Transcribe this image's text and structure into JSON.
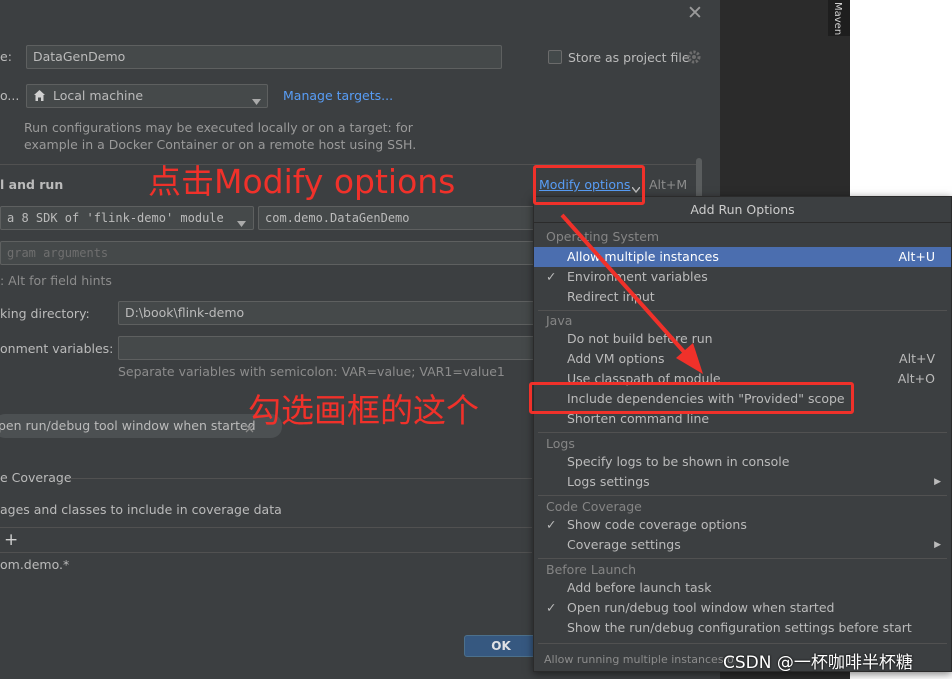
{
  "dialog": {
    "name_label": "e:",
    "name_value": "DataGenDemo",
    "store_label": "Store as project file",
    "run_on_label": "o...",
    "run_target": "Local machine",
    "manage_targets": "Manage targets...",
    "info_line1": "Run configurations may be executed locally or on a target: for",
    "info_line2": "example in a Docker Container or on a remote host using SSH.",
    "build_run_title": "l and run",
    "modify_options": "Modify options",
    "modify_shortcut": "Alt+M",
    "sdk_value": "a 8 SDK of 'flink-demo' module",
    "main_class": "com.demo.DataGenDemo",
    "program_args_placeholder": "gram arguments",
    "field_hints": ": Alt for field hints",
    "working_dir_label": "king directory:",
    "working_dir_value": "D:\\book\\flink-demo",
    "env_label": "onment variables:",
    "env_hint": "Separate variables with semicolon: VAR=value; VAR1=value1",
    "open_tool_window": "pen run/debug tool window when started",
    "coverage_title": "e Coverage",
    "coverage_include": "ages and classes to include in coverage data",
    "add_symbol": "+",
    "coverage_pattern": "om.demo.*",
    "ok_label": "OK",
    "close_symbol": "✕"
  },
  "side": {
    "maven_label": "Maven"
  },
  "popup": {
    "title": "Add Run Options",
    "groups": {
      "os": "Operating System",
      "java": "Java",
      "logs": "Logs",
      "coverage": "Code Coverage",
      "before": "Before Launch"
    },
    "items": [
      {
        "label": "Allow multiple instances",
        "shortcut": "Alt+U"
      },
      {
        "label": "Environment variables"
      },
      {
        "label": "Redirect input"
      },
      {
        "label": "Do not build before run"
      },
      {
        "label": "Add VM options",
        "shortcut": "Alt+V"
      },
      {
        "label": "Use classpath of module",
        "shortcut": "Alt+O"
      },
      {
        "label": "Include dependencies with \"Provided\" scope"
      },
      {
        "label": "Shorten command line"
      },
      {
        "label": "Specify logs to be shown in console"
      },
      {
        "label": "Logs settings"
      },
      {
        "label": "Show code coverage options"
      },
      {
        "label": "Coverage settings"
      },
      {
        "label": "Add before launch task"
      },
      {
        "label": "Open run/debug tool window when started"
      },
      {
        "label": "Show the run/debug configuration settings before start"
      }
    ],
    "footer": "Allow running multiple instances o"
  },
  "annotations": {
    "click_modify": "点击Modify options",
    "check_this": "勾选画框的这个",
    "watermark": "CSDN @一杯咖啡半杯糖"
  }
}
